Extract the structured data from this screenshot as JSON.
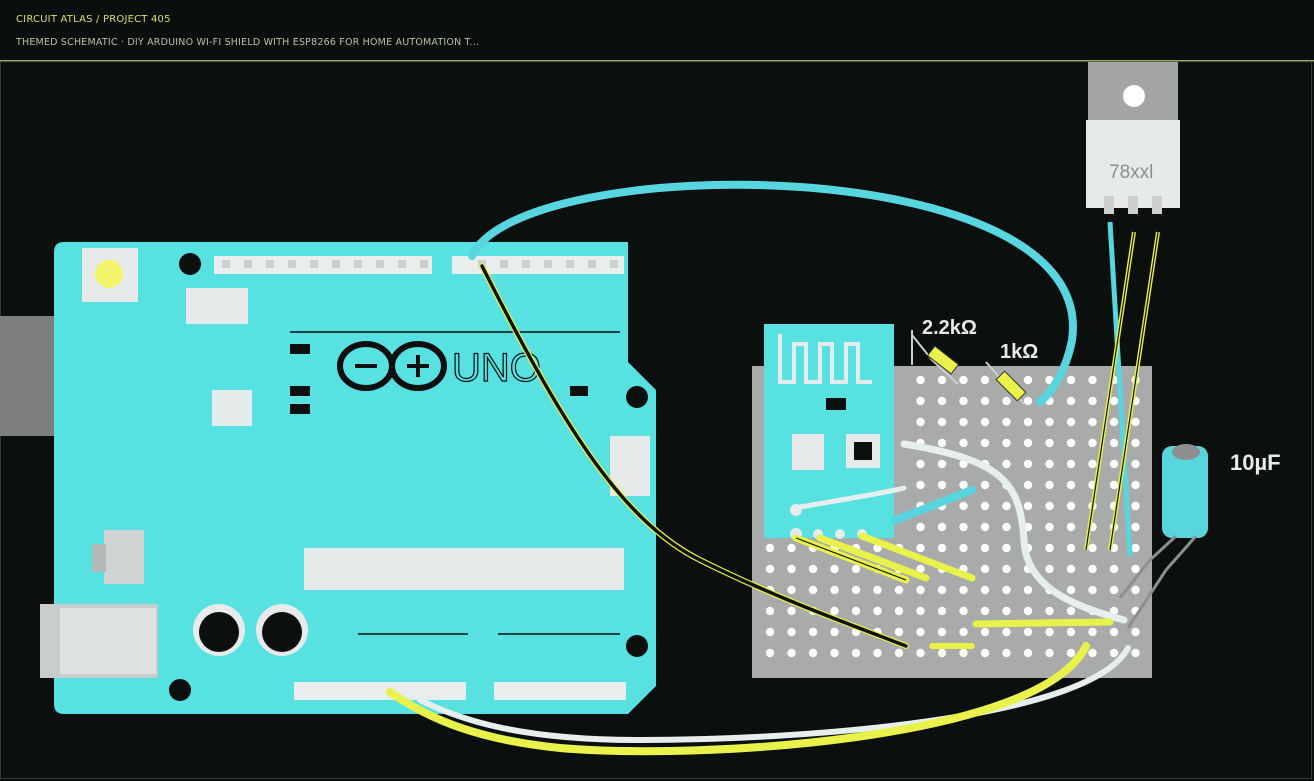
{
  "header": {
    "project": "CIRCUIT ATLAS / PROJECT 405",
    "subtitle": "THEMED SCHEMATIC · DIY ARDUINO WI-FI SHIELD WITH ESP8266 FOR HOME AUTOMATION T..."
  },
  "board": {
    "logo_text": "UNO"
  },
  "components": {
    "r1_label": "2.2kΩ",
    "r2_label": "1kΩ",
    "regulator_label": "78xxl",
    "capacitor_label": "10µF"
  },
  "colors": {
    "background": "#0b0f0d",
    "board": "#57e1e0",
    "wire_cyan": "#57d6e0",
    "wire_yellow": "#e8f24a",
    "wire_white": "#e6eeee",
    "wire_black": "#111111",
    "perfboard": "#a9abab",
    "accent": "#d6e06a"
  }
}
